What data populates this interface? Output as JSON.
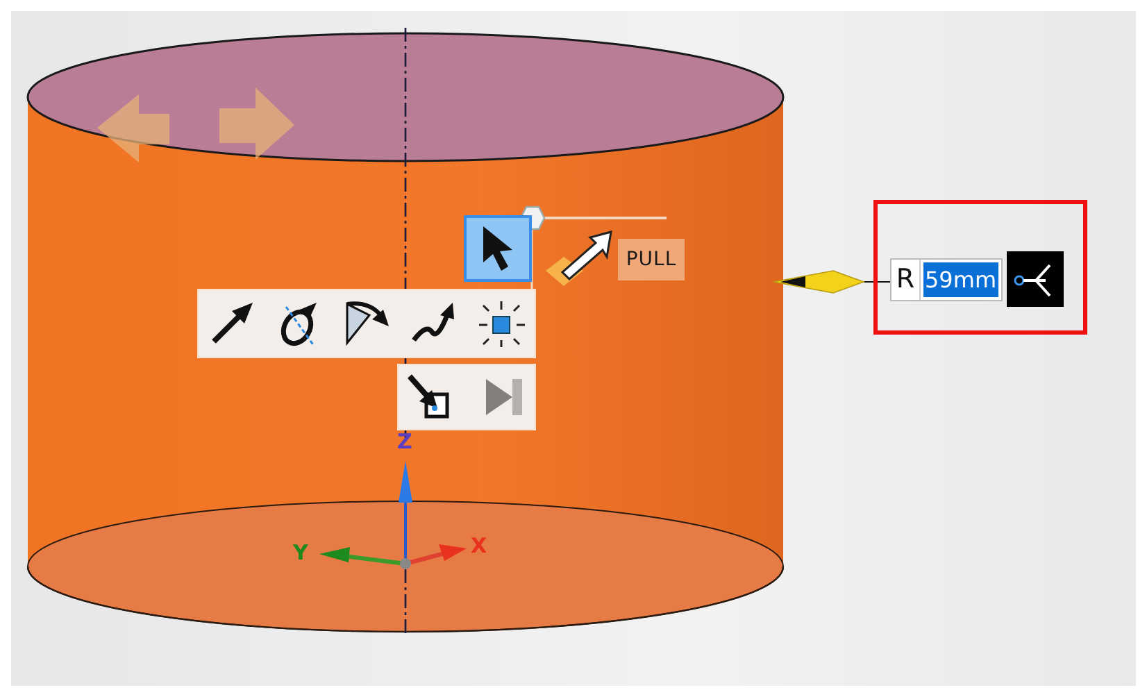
{
  "viewport": {
    "axes": [
      {
        "label": "Z",
        "color": "#5b3fc0"
      },
      {
        "label": "Y",
        "color": "#1e8a1e"
      },
      {
        "label": "X",
        "color": "#e8321e"
      }
    ]
  },
  "tool_guide": {
    "select_tool": {
      "selected": true
    },
    "label": "PULL"
  },
  "tools": [
    {
      "kind": "direction"
    },
    {
      "kind": "axis"
    },
    {
      "kind": "angle"
    },
    {
      "kind": "path"
    },
    {
      "kind": "scale"
    }
  ],
  "secondary_tools": [
    {
      "kind": "select-body",
      "disabled": false
    },
    {
      "kind": "complete",
      "disabled": true
    }
  ],
  "dimension": {
    "prefix": "R",
    "value": "59mm",
    "highlighted": true
  }
}
